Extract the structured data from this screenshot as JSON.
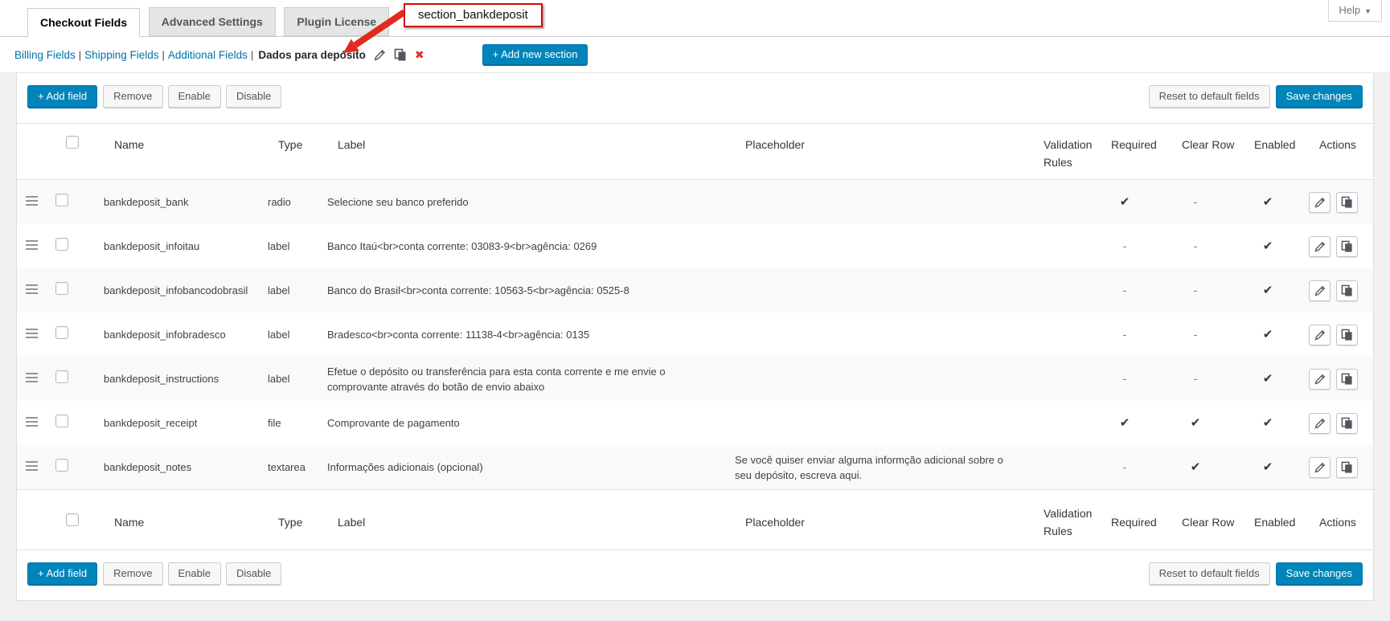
{
  "tabs": [
    {
      "label": "Checkout Fields",
      "active": true
    },
    {
      "label": "Advanced Settings",
      "active": false
    },
    {
      "label": "Plugin License",
      "active": false
    }
  ],
  "help": {
    "label": "Help",
    "arrow": "▼"
  },
  "section_nav": {
    "links": [
      "Billing Fields",
      "Shipping Fields",
      "Additional Fields"
    ],
    "separator": "|",
    "current": "Dados para depósito",
    "add_button": "+ Add new section"
  },
  "callout": {
    "text": "section_bankdeposit"
  },
  "toolbar": {
    "add_field": "+ Add field",
    "remove": "Remove",
    "enable": "Enable",
    "disable": "Disable",
    "reset": "Reset to default fields",
    "save": "Save changes"
  },
  "table": {
    "headers": {
      "name": "Name",
      "type": "Type",
      "label": "Label",
      "placeholder": "Placeholder",
      "validation": "Validation Rules",
      "required": "Required",
      "clear_row": "Clear Row",
      "enabled": "Enabled",
      "actions": "Actions"
    },
    "rows": [
      {
        "name": "bankdeposit_bank",
        "type": "radio",
        "label": "Selecione seu banco preferido",
        "placeholder": "",
        "validation": "",
        "required": "✔",
        "clear_row": "-",
        "enabled": "✔"
      },
      {
        "name": "bankdeposit_infoitau",
        "type": "label",
        "label": "Banco Itaú<br>conta corrente: 03083-9<br>agência: 0269",
        "placeholder": "",
        "validation": "",
        "required": "-",
        "clear_row": "-",
        "enabled": "✔"
      },
      {
        "name": "bankdeposit_infobancodobrasil",
        "type": "label",
        "label": "Banco do Brasil<br>conta corrente: 10563-5<br>agência: 0525-8",
        "placeholder": "",
        "validation": "",
        "required": "-",
        "clear_row": "-",
        "enabled": "✔"
      },
      {
        "name": "bankdeposit_infobradesco",
        "type": "label",
        "label": "Bradesco<br>conta corrente: 11138-4<br>agência: 0135",
        "placeholder": "",
        "validation": "",
        "required": "-",
        "clear_row": "-",
        "enabled": "✔"
      },
      {
        "name": "bankdeposit_instructions",
        "type": "label",
        "label": "Efetue o depósito ou transferência para esta conta corrente e me envie o comprovante através do botão de envio abaixo",
        "placeholder": "",
        "validation": "",
        "required": "-",
        "clear_row": "-",
        "enabled": "✔"
      },
      {
        "name": "bankdeposit_receipt",
        "type": "file",
        "label": "Comprovante de pagamento",
        "placeholder": "",
        "validation": "",
        "required": "✔",
        "clear_row": "✔",
        "enabled": "✔"
      },
      {
        "name": "bankdeposit_notes",
        "type": "textarea",
        "label": "Informações adicionais (opcional)",
        "placeholder": "Se você quiser enviar alguma informção adicional sobre o seu depósito, escreva aqui.",
        "validation": "",
        "required": "-",
        "clear_row": "✔",
        "enabled": "✔"
      }
    ]
  },
  "colors": {
    "primary_button": "#0085ba",
    "link": "#0073aa",
    "callout_border": "#cf0a0a",
    "arrow_red": "#e02b20",
    "delete_x": "#dc3232",
    "stripe_row": "#f9f9f9"
  }
}
